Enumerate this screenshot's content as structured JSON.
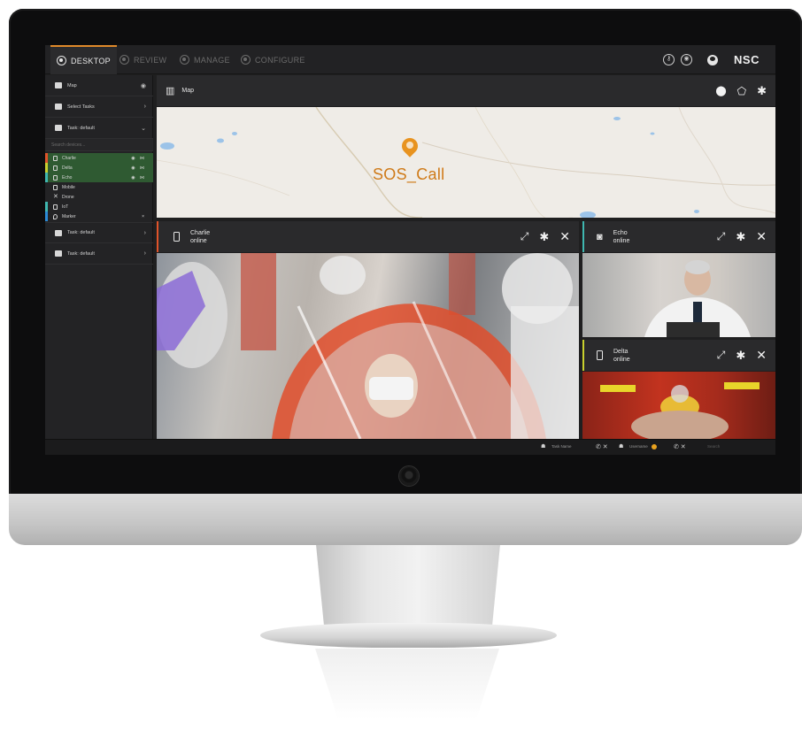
{
  "nav": {
    "tabs": [
      {
        "label": "DESKTOP",
        "active": true
      },
      {
        "label": "REVIEW",
        "active": false
      },
      {
        "label": "MANAGE",
        "active": false
      },
      {
        "label": "CONFIGURE",
        "active": false
      }
    ],
    "logo": "NSC"
  },
  "sidebar": {
    "map_label": "Map",
    "select_tasks": "Select Tasks",
    "task_expanded": "Task: default",
    "search_placeholder": "Search devices...",
    "units": [
      {
        "label": "Charlie",
        "highlight": true,
        "color": "#e0532a"
      },
      {
        "label": "Delta",
        "highlight": true,
        "color": "#c8d02e"
      },
      {
        "label": "Echo",
        "highlight": true,
        "color": "#3fb7b0"
      },
      {
        "label": "Mobile",
        "highlight": false,
        "color": "#6a6a6a"
      },
      {
        "label": "Drone",
        "highlight": false,
        "color": "#6a6a6a"
      },
      {
        "label": "IoT",
        "highlight": false,
        "color": "#3fb7b0"
      },
      {
        "label": "Marker",
        "highlight": false,
        "color": "#2b8ad6"
      }
    ],
    "task_collapsed_1": "Task: default",
    "task_collapsed_2": "Task: default"
  },
  "map_panel": {
    "title": "Map",
    "marker_label": "SOS_Call",
    "accent": "#e8931f"
  },
  "panels": [
    {
      "name": "Charlie",
      "status": "online",
      "accent": "#e0532a"
    },
    {
      "name": "Echo",
      "status": "online",
      "accent": "#3fb7b0"
    },
    {
      "name": "Delta",
      "status": "online",
      "accent": "#c8d02e"
    }
  ],
  "footer": {
    "task_name": "Task Name",
    "username": "Username",
    "search": "Search"
  }
}
